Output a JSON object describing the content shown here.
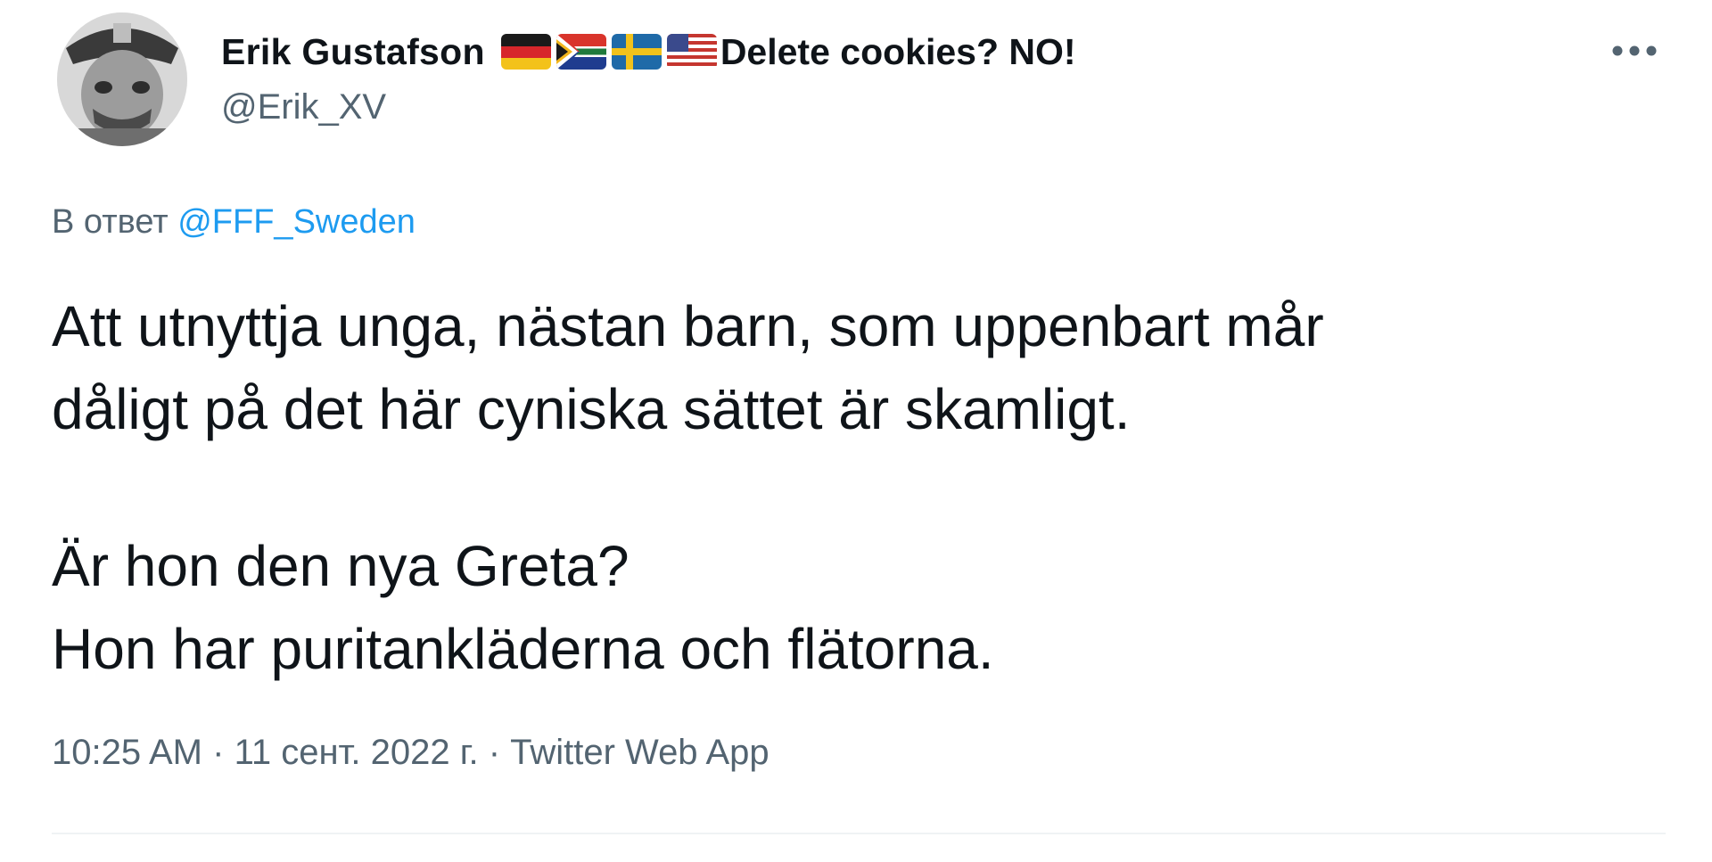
{
  "tweet": {
    "author": {
      "display_name": "Erik Gustafson",
      "flags": [
        "germany-flag",
        "south-africa-flag",
        "sweden-flag",
        "usa-flag"
      ],
      "bio_suffix": "Delete cookies? NO!",
      "handle": "@Erik_XV"
    },
    "more_icon": "more-horizontal-icon",
    "reply": {
      "prefix": "В ответ",
      "mention": "@FFF_Sweden"
    },
    "body": {
      "line1": "Att utnyttja unga, nästan barn, som uppenbart mår",
      "line2": "dåligt på det här cyniska sättet är skamligt.",
      "line3": "Är hon den nya Greta?",
      "line4": "Hon har puritankläderna och flätorna."
    },
    "meta": {
      "time": "10:25 AM",
      "sep1": " · ",
      "date": "11 сент. 2022 г.",
      "sep2": " · ",
      "source": "Twitter Web App"
    }
  },
  "colors": {
    "text_primary": "#0f1419",
    "text_secondary": "#536471",
    "link": "#1d9bf0",
    "divider": "#eff3f4"
  }
}
